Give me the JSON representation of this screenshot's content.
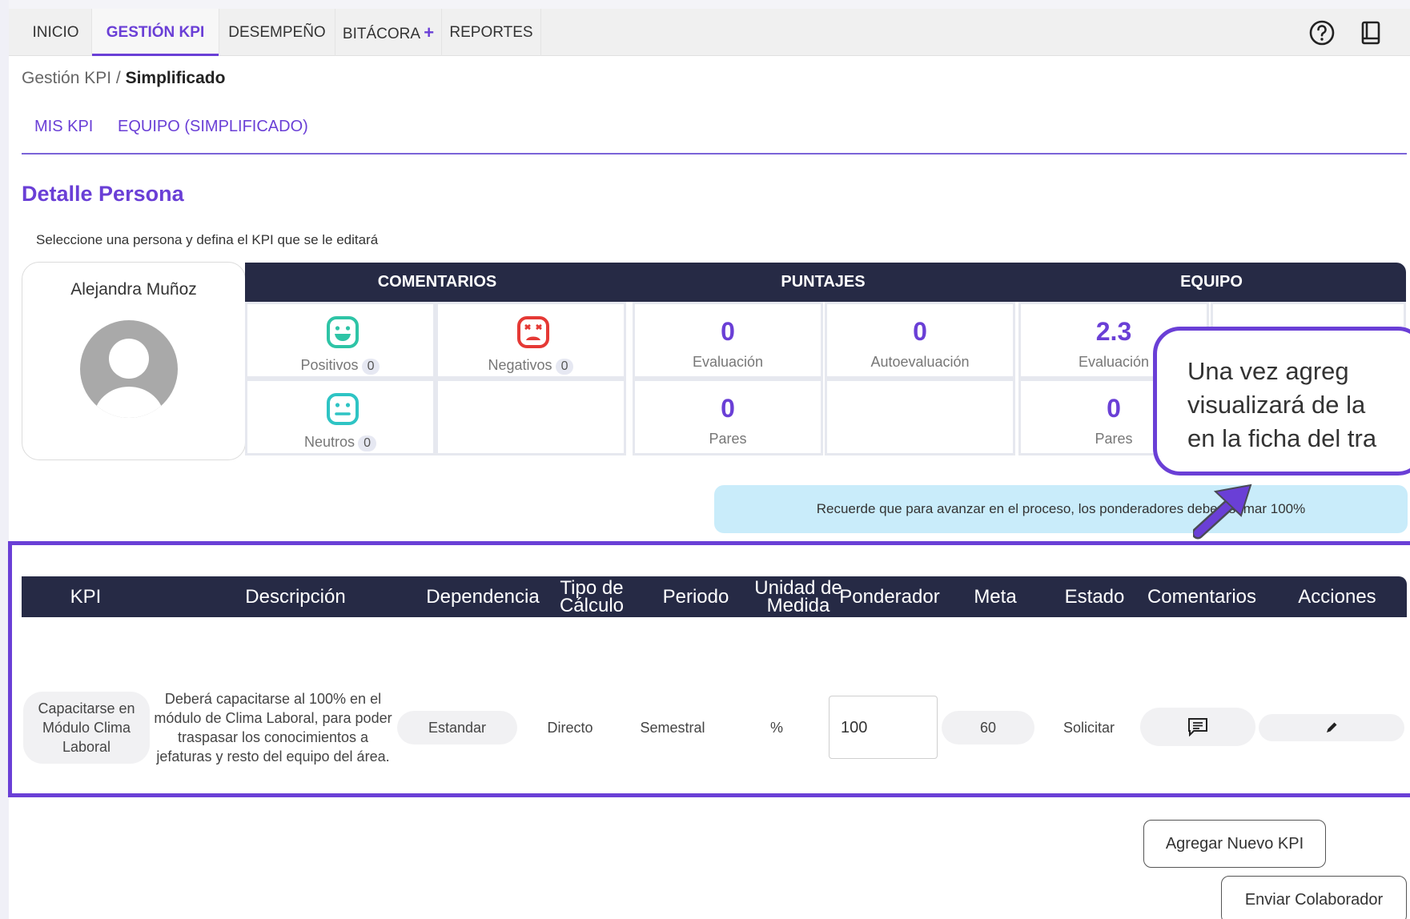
{
  "nav": {
    "items": [
      "INICIO",
      "GESTIÓN KPI",
      "DESEMPEÑO",
      "BITÁCORA",
      "REPORTES"
    ],
    "plus": "+",
    "help_icon": "help-circle-icon",
    "book_icon": "book-icon"
  },
  "breadcrumb": {
    "root": "Gestión KPI",
    "separator": " / ",
    "current": "Simplificado"
  },
  "subtabs": [
    "MIS KPI",
    "EQUIPO (SIMPLIFICADO)"
  ],
  "section_title": "Detalle Persona",
  "instruction": "Seleccione una persona y defina el KPI que se le editará",
  "person": {
    "name": "Alejandra Muñoz"
  },
  "headers": {
    "comentarios": "COMENTARIOS",
    "puntajes": "PUNTAJES",
    "equipo": "EQUIPO"
  },
  "comments": {
    "positivos": {
      "label": "Positivos",
      "count": "0",
      "color": "#2ec4a6"
    },
    "negativos": {
      "label": "Negativos",
      "count": "0",
      "color": "#e53935"
    },
    "neutros": {
      "label": "Neutros",
      "count": "0",
      "color": "#2ec4c4"
    }
  },
  "scores": {
    "evaluacion": {
      "value": "0",
      "label": "Evaluación"
    },
    "autoevaluacion": {
      "value": "0",
      "label": "Autoevaluación"
    },
    "pares": {
      "value": "0",
      "label": "Pares"
    }
  },
  "team": {
    "evaluacion": {
      "value": "2.3",
      "label": "Evaluación"
    },
    "pares": {
      "value": "0",
      "label": "Pares"
    }
  },
  "callout": "Una vez agreg\nvisualizará de la\nen la ficha del tra",
  "notice": "Recuerde que para avanzar en el proceso, los ponderadores deben sumar 100%",
  "table": {
    "headers": {
      "kpi": "KPI",
      "descripcion": "Descripción",
      "dependencia": "Dependencia",
      "tipo_l1": "Tipo de",
      "tipo_l2": "Cálculo",
      "periodo": "Periodo",
      "unidad_l1": "Unidad de",
      "unidad_l2": "Medida",
      "ponderador": "Ponderador",
      "meta": "Meta",
      "estado": "Estado",
      "comentarios": "Comentarios",
      "acciones": "Acciones"
    },
    "row": {
      "kpi": "Capacitarse en Módulo Clima Laboral",
      "descripcion": "Deberá capacitarse al 100% en el módulo de Clima Laboral, para poder traspasar los conocimientos a jefaturas y resto del equipo del área.",
      "dependencia": "Estandar",
      "tipo": "Directo",
      "periodo": "Semestral",
      "unidad": "%",
      "ponderador": "100",
      "meta": "60",
      "estado": "Solicitar",
      "comentarios_icon": "comment-icon",
      "acciones_icon": "pencil-icon"
    }
  },
  "buttons": {
    "add_kpi": "Agregar Nuevo KPI",
    "send": "Enviar Colaborador"
  },
  "colors": {
    "accent": "#6a3fd6",
    "header_dark": "#262a45",
    "notice_bg": "#c9ecfa"
  }
}
